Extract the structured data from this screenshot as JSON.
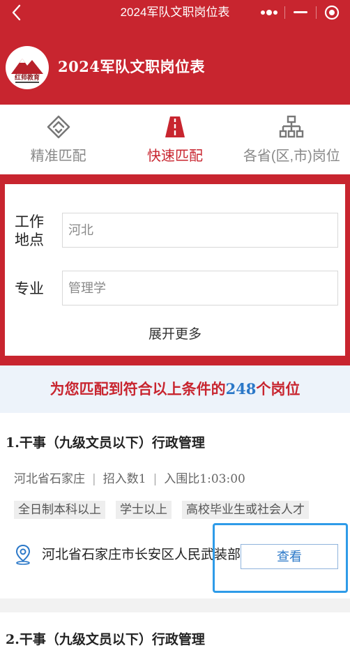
{
  "navbar": {
    "back_icon": "chevron-left-icon",
    "title": "2024军队文职岗位表",
    "more_icon": "more-dots-icon",
    "minimize_icon": "minimize-icon",
    "close_icon": "target-close-icon"
  },
  "header": {
    "logo_text": "红师教育",
    "title": "2024军队文职岗位表"
  },
  "tabs": [
    {
      "label": "精准匹配",
      "icon": "diamond-layers-icon",
      "active": false
    },
    {
      "label": "快速匹配",
      "icon": "road-icon",
      "active": true
    },
    {
      "label": "各省(区,市)岗位",
      "icon": "org-chart-icon",
      "active": false
    }
  ],
  "filter": {
    "location_label": "工作地点",
    "location_label_line1": "工作",
    "location_label_line2": "地点",
    "location_value": "河北",
    "major_label": "专业",
    "major_value": "管理学",
    "expand_label": "展开更多"
  },
  "result": {
    "prefix": "为您匹配到符合以上条件的",
    "count": "248",
    "suffix": "个岗位"
  },
  "jobs": [
    {
      "title": "1.干事（九级文员以下）行政管理",
      "city": "河北省石家庄",
      "quota": "招入数1",
      "ratio": "入围比1:03:00",
      "tags": [
        "全日制本科以上",
        "学士以上",
        "高校毕业生或社会人才"
      ],
      "address": "河北省石家庄市长安区人民武装部",
      "view_label": "查看"
    },
    {
      "title": "2.干事（九级文员以下）行政管理"
    }
  ],
  "colors": {
    "brand_red": "#c8252f",
    "accent_blue": "#2b78c8",
    "result_bg": "#edf3fa"
  }
}
